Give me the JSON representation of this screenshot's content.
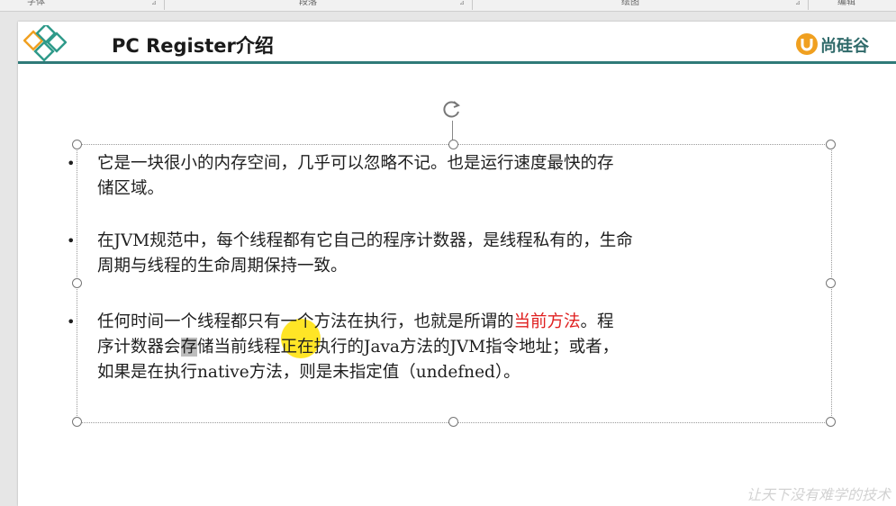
{
  "ribbon": {
    "groups": [
      "字体",
      "段落",
      "绘图",
      "编辑"
    ]
  },
  "slide": {
    "title": "PC Register介绍",
    "logo_text": "尚硅谷",
    "colors": {
      "accent_teal": "#2f7a78",
      "highlight_red": "#e02020"
    },
    "bullets": [
      {
        "line1": "它是一块很小的内存空间，几乎可以忽略不记。也是运行速度最快的存",
        "line2": "储区域。"
      },
      {
        "line1": "在JVM规范中，每个线程都有它自己的程序计数器，是线程私有的，生命",
        "line2": "周期与线程的生命周期保持一致。"
      },
      {
        "line1_a": "任何时间一个线程都只有一个方法在执行，也就是所谓的",
        "line1_red": "当前方法",
        "line1_b": "。程",
        "line2_a": "序计数器会",
        "line2_sel": "存",
        "line2_b": "储当前线程正在执行的Java方法的JVM指令地址；或者，",
        "line3": "如果是在执行native方法，则是未指定值（undefned）。"
      }
    ],
    "watermark": "让天下没有难学的技术"
  }
}
